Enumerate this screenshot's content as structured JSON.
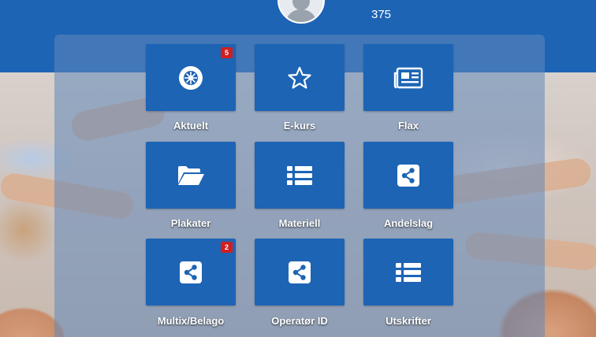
{
  "header": {
    "count": "375",
    "avatar_icon": "user-avatar-icon"
  },
  "tiles": [
    {
      "label": "Aktuelt",
      "icon": "snowflake-seal-icon",
      "badge": "5"
    },
    {
      "label": "E-kurs",
      "icon": "star-outline-icon",
      "badge": ""
    },
    {
      "label": "Flax",
      "icon": "newspaper-icon",
      "badge": ""
    },
    {
      "label": "Plakater",
      "icon": "folder-open-icon",
      "badge": ""
    },
    {
      "label": "Materiell",
      "icon": "list-icon",
      "badge": ""
    },
    {
      "label": "Andelslag",
      "icon": "share-icon",
      "badge": ""
    },
    {
      "label": "Multix/Belago",
      "icon": "share-icon",
      "badge": "2"
    },
    {
      "label": "Operatør ID",
      "icon": "share-icon",
      "badge": ""
    },
    {
      "label": "Utskrifter",
      "icon": "list-icon",
      "badge": ""
    }
  ],
  "colors": {
    "header_blue": "#1d64b5",
    "tile_blue": "#1d64b5",
    "badge_red": "#d11f1f"
  }
}
